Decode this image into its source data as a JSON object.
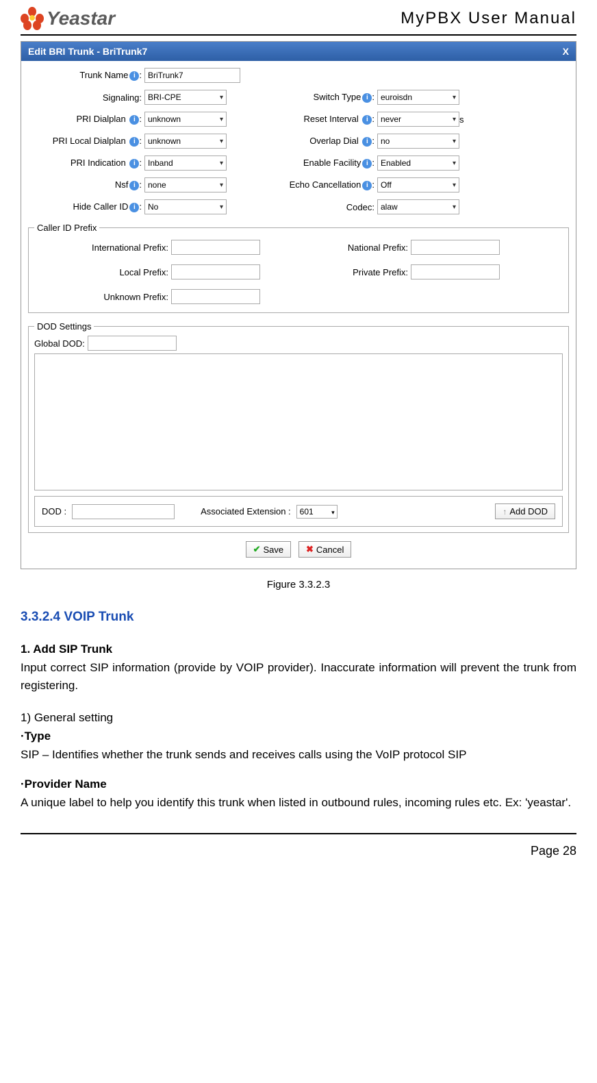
{
  "header": {
    "brand": "Yeastar",
    "doc_title": "MyPBX User Manual"
  },
  "dialog": {
    "title": "Edit BRI Trunk - BriTrunk7",
    "close": "X",
    "fields": {
      "trunk_name_label": "Trunk Name",
      "trunk_name_value": "BriTrunk7",
      "signaling_label": "Signaling:",
      "signaling_value": "BRI-CPE",
      "switch_type_label": "Switch Type",
      "switch_type_value": "euroisdn",
      "pri_dialplan_label": "PRI Dialplan",
      "pri_dialplan_value": "unknown",
      "reset_interval_label": "Reset Interval",
      "reset_interval_value": "never",
      "reset_suffix": "s",
      "pri_local_dialplan_label": "PRI Local Dialplan",
      "pri_local_dialplan_value": "unknown",
      "overlap_dial_label": "Overlap Dial",
      "overlap_dial_value": "no",
      "pri_indication_label": "PRI Indication",
      "pri_indication_value": "Inband",
      "enable_facility_label": "Enable Facility",
      "enable_facility_value": "Enabled",
      "nsf_label": "Nsf",
      "nsf_value": "none",
      "echo_cancel_label": "Echo Cancellation",
      "echo_cancel_value": "Off",
      "hide_caller_label": "Hide Caller ID",
      "hide_caller_value": "No",
      "codec_label": "Codec:",
      "codec_value": "alaw"
    },
    "prefix_legend": "Caller ID Prefix",
    "prefix": {
      "intl_label": "International Prefix:",
      "national_label": "National Prefix:",
      "local_label": "Local Prefix:",
      "private_label": "Private Prefix:",
      "unknown_label": "Unknown Prefix:"
    },
    "dod": {
      "legend": "DOD Settings",
      "global_label": "Global DOD:",
      "dod_label": "DOD :",
      "assoc_label": "Associated Extension :",
      "assoc_value": "601",
      "add_btn": "Add DOD"
    },
    "buttons": {
      "save": "Save",
      "cancel": "Cancel"
    }
  },
  "caption": "Figure 3.3.2.3",
  "content": {
    "section_title": "3.3.2.4 VOIP Trunk",
    "h1": "1. Add SIP Trunk",
    "p1": "Input correct SIP information (provide by VOIP provider). Inaccurate information will prevent the trunk from registering.",
    "p2": "1) General setting",
    "h_type": "·Type",
    "p_type": "SIP – Identifies whether the trunk sends and receives calls using the VoIP protocol SIP",
    "h_provider": "·Provider Name",
    "p_provider": "A unique label to help you identify this trunk when listed in outbound rules, incoming rules etc. Ex: 'yeastar'."
  },
  "footer": {
    "page": "Page 28"
  },
  "info": "i"
}
